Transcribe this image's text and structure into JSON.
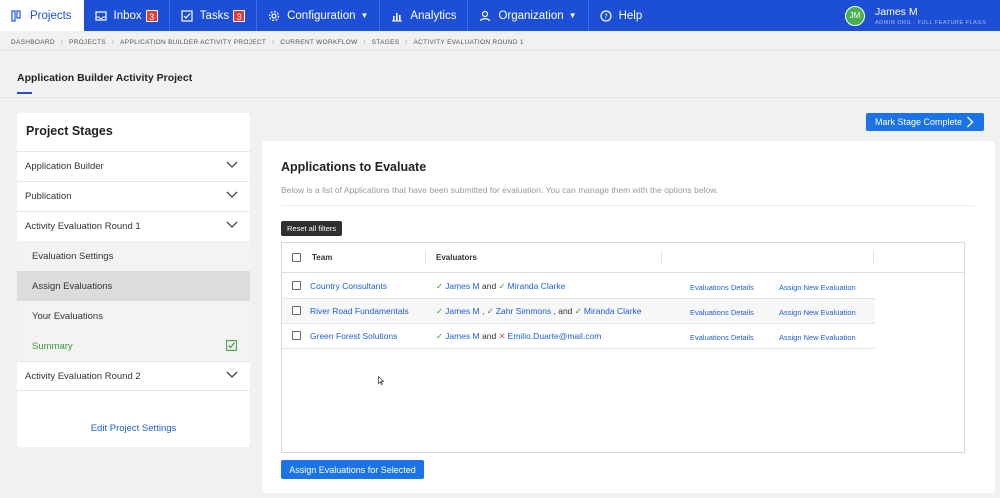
{
  "nav": {
    "items": [
      {
        "label": "Projects",
        "icon": "projects-icon"
      },
      {
        "label": "Inbox",
        "icon": "inbox-icon",
        "badge": "3"
      },
      {
        "label": "Tasks",
        "icon": "tasks-icon",
        "badge": "3"
      },
      {
        "label": "Configuration",
        "icon": "gear-icon"
      },
      {
        "label": "Analytics",
        "icon": "bar-chart-icon"
      },
      {
        "label": "Organization",
        "icon": "user-icon"
      },
      {
        "label": "Help",
        "icon": "help-icon"
      }
    ],
    "user": {
      "initials": "JM",
      "name": "James M",
      "subtitle": "ADMIN ORG - FULL FEATURE FLAGS"
    }
  },
  "breadcrumb": [
    "DASHBOARD",
    "PROJECTS",
    "APPLICATION BUILDER ACTIVITY PROJECT",
    "CURRENT WORKFLOW",
    "STAGES",
    "ACTIVITY EVALUATION ROUND 1"
  ],
  "project_title": "Application Builder Activity Project",
  "sidebar": {
    "title": "Project Stages",
    "stages": [
      "Application Builder",
      "Publication",
      "Activity Evaluation Round 1"
    ],
    "sub_items": [
      "Evaluation Settings",
      "Assign Evaluations",
      "Your Evaluations",
      "Summary"
    ],
    "last_stage": "Activity Evaluation Round 2",
    "edit_link": "Edit Project Settings"
  },
  "mark_complete_label": "Mark Stage Complete",
  "main": {
    "title": "Applications to Evaluate",
    "description": "Below is a list of Applications that have been submitted for evaluation. You can manage them with the options below.",
    "reset_label": "Reset all filters",
    "columns": {
      "team": "Team",
      "evaluators": "Evaluators"
    },
    "rows": [
      {
        "team": "Country Consultants",
        "ev1": "James M",
        "j1": "and",
        "ev2": "Miranda Clarke",
        "j2": "",
        "ev3": "",
        "details": "Evaluations Details",
        "assign": "Assign New Evaluation"
      },
      {
        "team": "River Road Fundamentals",
        "ev1": "James M",
        "j1": ",",
        "ev2": "Zahr Simmons",
        "j2": ", and",
        "ev3": "Miranda Clarke",
        "details": "Evaluations Details",
        "assign": "Assign New Evaluation"
      },
      {
        "team": "Green Forest Solutions",
        "ev1": "James M",
        "j1": "and",
        "ev2": "Emilio.Duarte@mail.com",
        "j2": "",
        "ev3": "",
        "details": "Evaluations Details",
        "assign": "Assign New Evaluation"
      }
    ],
    "assign_selected_label": "Assign Evaluations for Selected"
  },
  "colors": {
    "brand_blue": "#1d4fd6",
    "button_blue": "#1a73e8",
    "ok_green": "#3a9c3a",
    "error_red": "#d9534f"
  }
}
